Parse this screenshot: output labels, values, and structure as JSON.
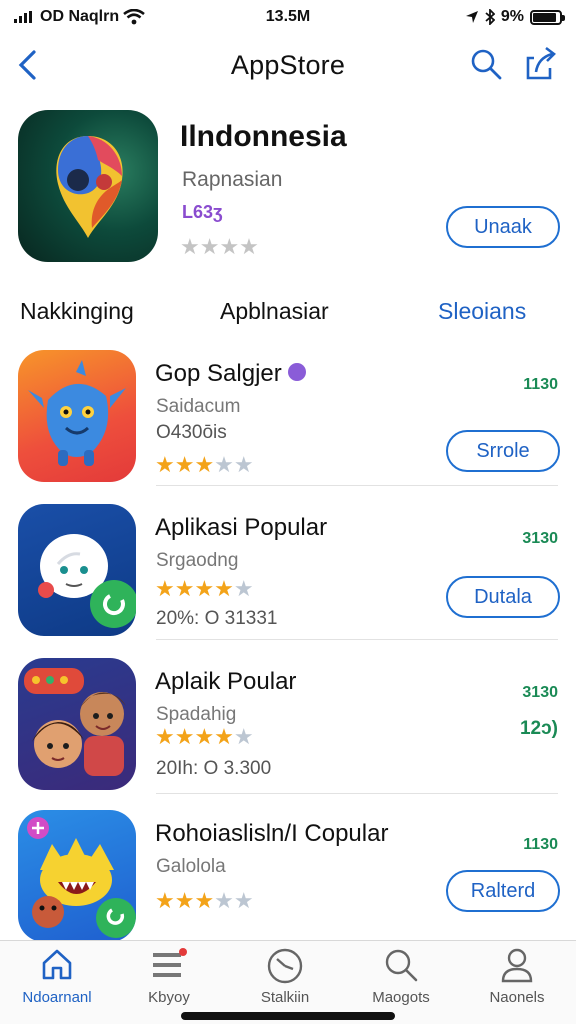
{
  "status_bar": {
    "carrier": "OD Naqlrn",
    "time": "13.5M",
    "battery": "9%",
    "battery_level": 0.9
  },
  "nav": {
    "title": "AppStore",
    "icons": [
      "chevron-left-icon",
      "search-icon",
      "share-icon"
    ]
  },
  "hero": {
    "title": "Ilndonnesia",
    "subtitle": "Rapnasian",
    "number": "L63ʒ",
    "rating": 0,
    "button_label": "Unaak"
  },
  "tabs": [
    {
      "label": "Nakkinging",
      "active": false
    },
    {
      "label": "Apblnasiar",
      "active": false
    },
    {
      "label": "Sleoians",
      "active": true
    }
  ],
  "apps": [
    {
      "name": "Gop Salgjer",
      "line2": "Saidacum",
      "line3": "O430ōis",
      "rating": 3,
      "rank": "1130",
      "rank2": "",
      "button": "Srrole"
    },
    {
      "name": "Aplikasi Popular",
      "line2": "Srgaodng",
      "line3": "20%: O 31331",
      "rating": 4,
      "rank": "3130",
      "rank2": "",
      "button": "Dutala"
    },
    {
      "name": "Aplaik Poular",
      "line2": "Spadahig",
      "line3": "20Ih: O 3.300",
      "rating": 4,
      "rank": "3130",
      "rank2": "12ɔ)",
      "button": ""
    },
    {
      "name": "Rohoiaslisln/I Copular",
      "line2": "Galolola",
      "line3": "",
      "rating": 3,
      "rank": "1130",
      "rank2": "",
      "button": "Ralterd"
    }
  ],
  "tabbar": [
    {
      "label": "Ndoarnanl",
      "icon": "home-icon",
      "active": true
    },
    {
      "label": "Kbyoy",
      "icon": "apps-icon",
      "active": false
    },
    {
      "label": "Stalkiin",
      "icon": "clock-icon",
      "active": false
    },
    {
      "label": "Maogots",
      "icon": "search-icon",
      "active": false
    },
    {
      "label": "Naonels",
      "icon": "person-icon",
      "active": false
    }
  ],
  "colors": {
    "accent": "#1f62c4",
    "star": "#f3a319",
    "rank": "#1a8a55",
    "hero_number": "#8a4ccf"
  }
}
